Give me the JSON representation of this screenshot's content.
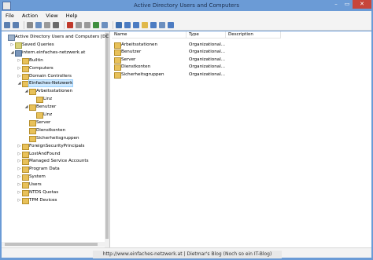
{
  "window": {
    "title": "Active Directory Users and Computers",
    "minimize_glyph": "–",
    "maximize_glyph": "▭",
    "close_glyph": "✕"
  },
  "menu": [
    "File",
    "Action",
    "View",
    "Help"
  ],
  "toolbar_icons": [
    "back-icon",
    "forward-icon",
    "up-icon",
    "show-hide-tree-icon",
    "copy-icon",
    "properties-icon",
    "delete-icon",
    "cut-icon",
    "paste-icon",
    "refresh-icon",
    "export-list-icon",
    "help-icon",
    "new-user-icon",
    "new-group-icon",
    "new-ou-icon",
    "filter-icon",
    "find-icon",
    "add-to-group-icon"
  ],
  "tree": [
    {
      "label": "Active Directory Users and Computers [DC1.intr",
      "level": 0,
      "exp": "",
      "icon": "root"
    },
    {
      "label": "Saved Queries",
      "level": 1,
      "exp": "▷",
      "icon": "saved"
    },
    {
      "label": "intern.einfaches-netzwerk.at",
      "level": 1,
      "exp": "◢",
      "icon": "domain"
    },
    {
      "label": "Builtin",
      "level": 2,
      "exp": "▷",
      "icon": "folder"
    },
    {
      "label": "Computers",
      "level": 2,
      "exp": "▷",
      "icon": "folder"
    },
    {
      "label": "Domain Controllers",
      "level": 2,
      "exp": "▷",
      "icon": "ou"
    },
    {
      "label": "Einfaches-Netzwerk",
      "level": 2,
      "exp": "◢",
      "icon": "ou",
      "selected": true
    },
    {
      "label": "Arbeitsstationen",
      "level": 3,
      "exp": "◢",
      "icon": "ou"
    },
    {
      "label": "Linz",
      "level": 4,
      "exp": "",
      "icon": "ou"
    },
    {
      "label": "Benutzer",
      "level": 3,
      "exp": "◢",
      "icon": "ou"
    },
    {
      "label": "Linz",
      "level": 4,
      "exp": "",
      "icon": "ou"
    },
    {
      "label": "Server",
      "level": 3,
      "exp": "",
      "icon": "ou"
    },
    {
      "label": "Dienstkonten",
      "level": 3,
      "exp": "",
      "icon": "ou"
    },
    {
      "label": "Sicherheitsgruppen",
      "level": 3,
      "exp": "",
      "icon": "ou"
    },
    {
      "label": "ForeignSecurityPrincipals",
      "level": 2,
      "exp": "▷",
      "icon": "folder"
    },
    {
      "label": "LostAndFound",
      "level": 2,
      "exp": "▷",
      "icon": "folder"
    },
    {
      "label": "Managed Service Accounts",
      "level": 2,
      "exp": "▷",
      "icon": "folder"
    },
    {
      "label": "Program Data",
      "level": 2,
      "exp": "▷",
      "icon": "folder"
    },
    {
      "label": "System",
      "level": 2,
      "exp": "▷",
      "icon": "folder"
    },
    {
      "label": "Users",
      "level": 2,
      "exp": "▷",
      "icon": "folder"
    },
    {
      "label": "NTDS Quotas",
      "level": 2,
      "exp": "▷",
      "icon": "folder"
    },
    {
      "label": "TPM Devices",
      "level": 2,
      "exp": "▷",
      "icon": "folder"
    }
  ],
  "list": {
    "columns": [
      "Name",
      "Type",
      "Description"
    ],
    "rows": [
      {
        "name": "Arbeitsstationen",
        "type": "Organizational...",
        "description": ""
      },
      {
        "name": "Benutzer",
        "type": "Organizational...",
        "description": ""
      },
      {
        "name": "Server",
        "type": "Organizational...",
        "description": ""
      },
      {
        "name": "Dienstkonten",
        "type": "Organizational...",
        "description": ""
      },
      {
        "name": "Sicherheitsgruppen",
        "type": "Organizational...",
        "description": ""
      }
    ]
  },
  "watermark": "http://www.einfaches-netzwerk.at | Dietmar's Blog (Noch so ein IT-Blog)",
  "colors": {
    "title_bar": "#6b9bd6",
    "close_button": "#c7463b",
    "selection": "#cce8ff",
    "folder": "#e8c15a"
  }
}
